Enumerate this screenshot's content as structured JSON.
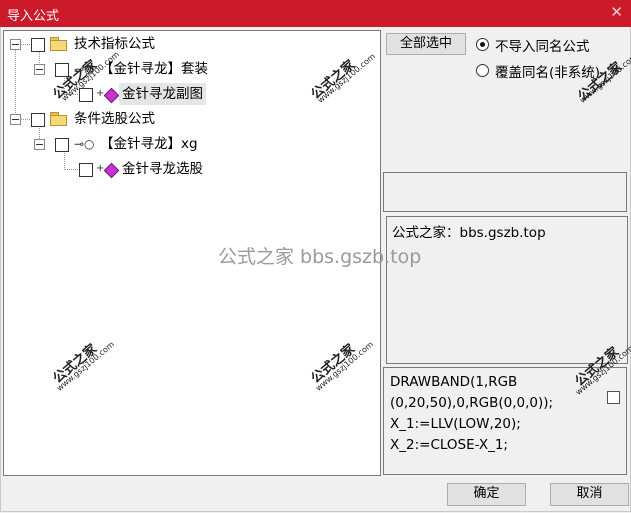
{
  "window": {
    "title": "导入公式",
    "close_glyph": "✕"
  },
  "tree": {
    "node1": {
      "label": "技术指标公式"
    },
    "node1_child": {
      "label": "【金针寻龙】套装"
    },
    "node1_grandchild": {
      "label": "金针寻龙副图"
    },
    "node2": {
      "label": "条件选股公式"
    },
    "node2_child": {
      "label": "【金针寻龙】xg"
    },
    "node2_grandchild": {
      "label": "金针寻龙选股"
    }
  },
  "options": {
    "select_all_label": "全部选中",
    "radio1_label": "不导入同名公式",
    "radio2_label": "覆盖同名(非系统)",
    "selected_radio": "radio1"
  },
  "info_text": "公式之家：bbs.gszb.top",
  "center_watermark": "公式之家 bbs.gszb.top",
  "code_lines": [
    "DRAWBAND(1,RGB",
    "(0,20,50),0,RGB(0,0,0));",
    "X_1:=LLV(LOW,20);",
    "X_2:=CLOSE-X_1;"
  ],
  "watermark": {
    "big": "公式之家",
    "small": "www.gszj100.com"
  },
  "buttons": {
    "ok": "确定",
    "cancel": "取消"
  },
  "colors": {
    "titlebar": "#cc1a2b",
    "gem": "#c832d6",
    "folder": "#f5d978"
  }
}
